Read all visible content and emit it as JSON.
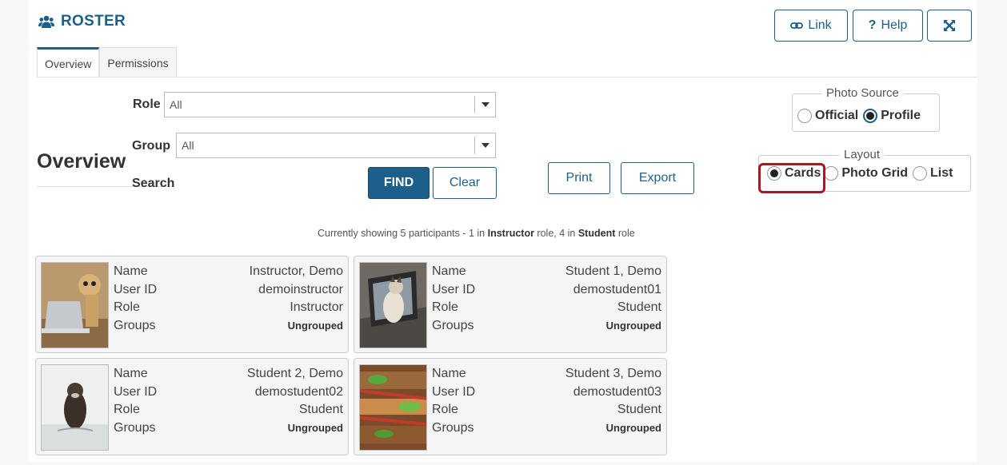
{
  "header": {
    "title": "ROSTER",
    "link_label": "Link",
    "help_label": "Help"
  },
  "tabs": [
    {
      "label": "Overview"
    },
    {
      "label": "Permissions"
    }
  ],
  "filters": {
    "role_label": "Role",
    "role_value": "All",
    "group_label": "Group",
    "group_value": "All",
    "search_label": "Search",
    "search_value": "",
    "find_label": "FIND",
    "clear_label": "Clear",
    "print_label": "Print",
    "export_label": "Export"
  },
  "heading": "Overview",
  "photo_source": {
    "legend": "Photo Source",
    "options": [
      "Official",
      "Profile"
    ],
    "selected": "Profile"
  },
  "layout": {
    "legend": "Layout",
    "options": [
      "Cards",
      "Photo Grid",
      "List"
    ],
    "selected": "Cards"
  },
  "status": {
    "prefix": "Currently showing 5 participants - 1 in ",
    "role1": "Instructor",
    "mid": " role, 4 in ",
    "role2": "Student",
    "suffix": " role"
  },
  "field_labels": {
    "name": "Name",
    "user_id": "User ID",
    "role": "Role",
    "groups": "Groups"
  },
  "participants": [
    {
      "name": "Instructor, Demo",
      "user_id": "demoinstructor",
      "role": "Instructor",
      "groups": "Ungrouped"
    },
    {
      "name": "Student 1, Demo",
      "user_id": "demostudent01",
      "role": "Student",
      "groups": "Ungrouped"
    },
    {
      "name": "Student 2, Demo",
      "user_id": "demostudent02",
      "role": "Student",
      "groups": "Ungrouped"
    },
    {
      "name": "Student 3, Demo",
      "user_id": "demostudent03",
      "role": "Student",
      "groups": "Ungrouped"
    }
  ],
  "colors": {
    "accent": "#1c5f8a",
    "highlight": "#a31b24"
  },
  "icons": [
    "users-icon",
    "link-icon",
    "question-icon",
    "expand-icon",
    "caret-down-icon"
  ]
}
